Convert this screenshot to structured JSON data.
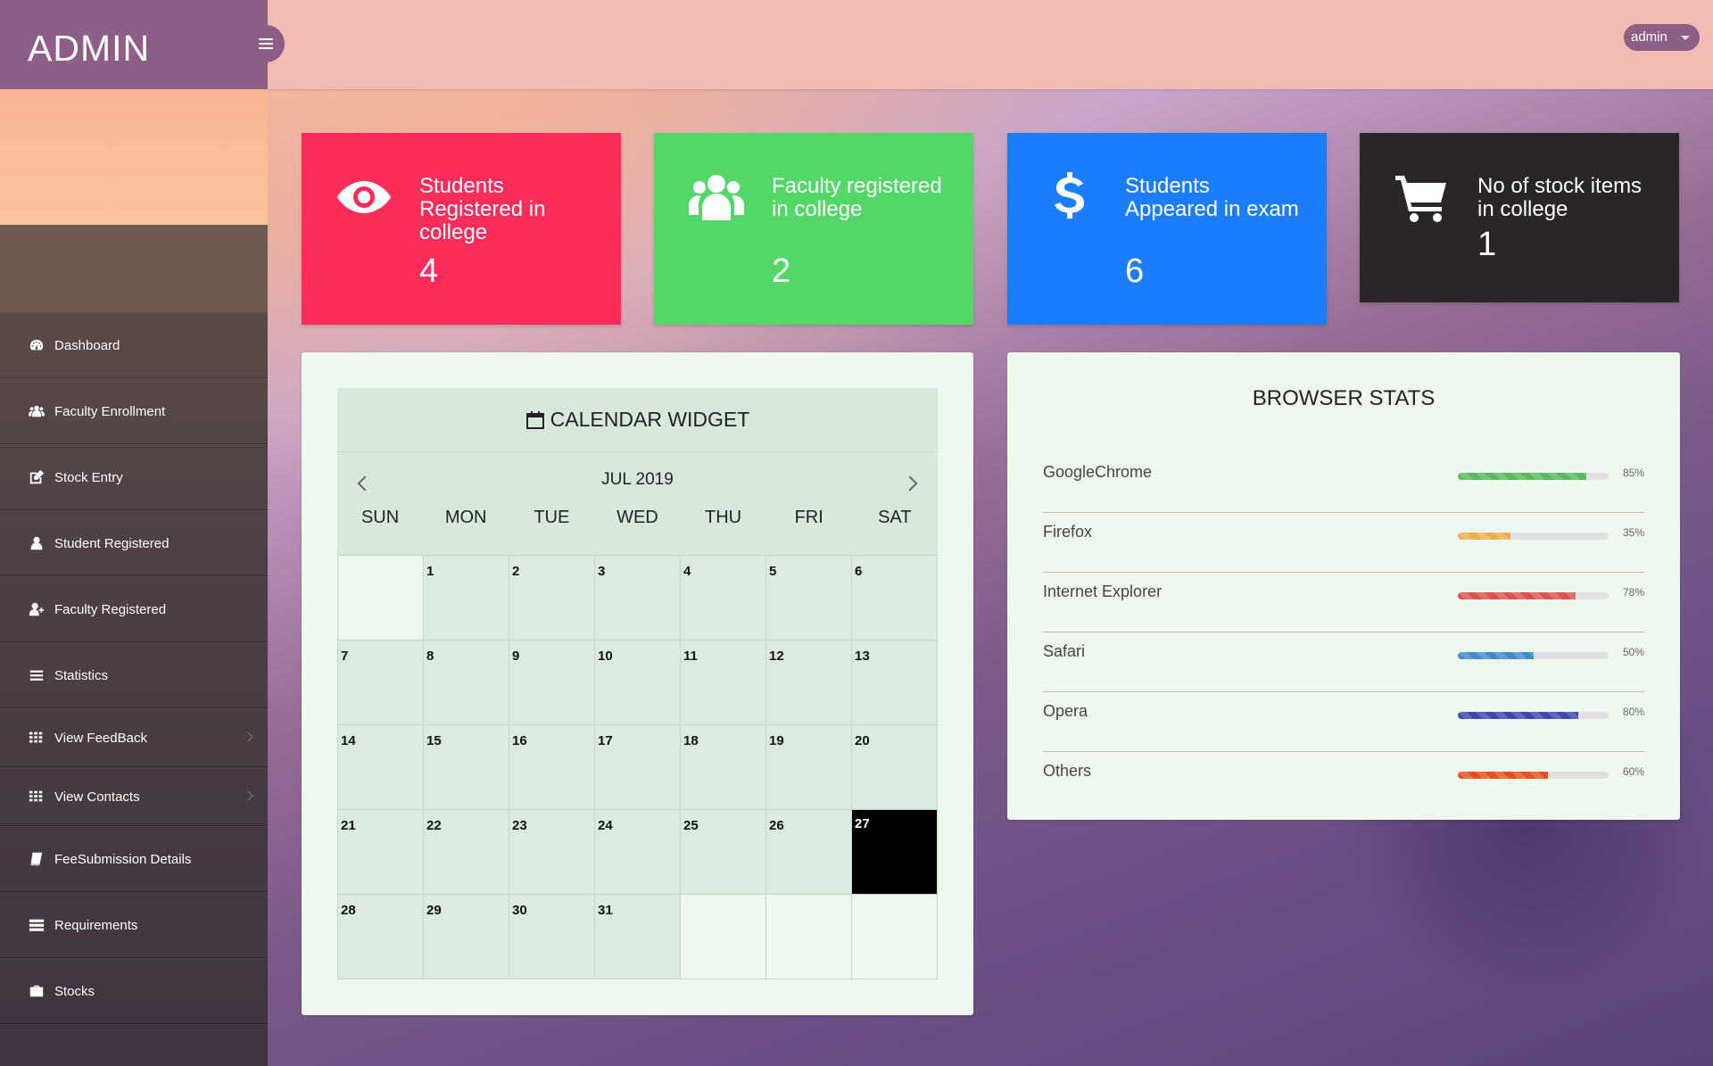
{
  "brand": {
    "title": "ADMIN"
  },
  "user": {
    "name": "admin"
  },
  "sidebar": {
    "items": [
      {
        "label": "Dashboard",
        "icon": "dashboard-icon"
      },
      {
        "label": "Faculty Enrollment",
        "icon": "users-icon"
      },
      {
        "label": "Stock Entry",
        "icon": "edit-icon"
      },
      {
        "label": "Student Registered",
        "icon": "user-icon"
      },
      {
        "label": "Faculty Registered",
        "icon": "user-plus-icon"
      },
      {
        "label": "Statistics",
        "icon": "list-icon"
      },
      {
        "label": "View FeedBack",
        "icon": "th-icon"
      },
      {
        "label": "View Contacts",
        "icon": "th-icon"
      },
      {
        "label": "FeeSubmission Details",
        "icon": "book-icon"
      },
      {
        "label": "Requirements",
        "icon": "tasks-icon"
      },
      {
        "label": "Stocks",
        "icon": "briefcase-icon"
      }
    ]
  },
  "stats": [
    {
      "label": "Students Registered in college",
      "count": "4",
      "icon": "eye-icon",
      "color": "#fb2d5a"
    },
    {
      "label": "Faculty registered in college",
      "count": "2",
      "icon": "users-icon",
      "color": "#53d769"
    },
    {
      "label": "Students Appeared in exam",
      "count": "6",
      "icon": "dollar-icon",
      "color": "#1a7eff"
    },
    {
      "label": "No of stock items in college",
      "count": "1",
      "icon": "cart-icon",
      "color": "#2a2526"
    }
  ],
  "calendar": {
    "title": "CALENDAR WIDGET",
    "month": "JUL 2019",
    "days_of_week": [
      "SUN",
      "MON",
      "TUE",
      "WED",
      "THU",
      "FRI",
      "SAT"
    ],
    "cells": [
      "",
      "1",
      "2",
      "3",
      "4",
      "5",
      "6",
      "7",
      "8",
      "9",
      "10",
      "11",
      "12",
      "13",
      "14",
      "15",
      "16",
      "17",
      "18",
      "19",
      "20",
      "21",
      "22",
      "23",
      "24",
      "25",
      "26",
      "27",
      "28",
      "29",
      "30",
      "31",
      "",
      "",
      ""
    ],
    "today": "27"
  },
  "browser_stats": {
    "title": "BROWSER STATS",
    "rows": [
      {
        "name": "GoogleChrome",
        "percent": "85%",
        "value": 85,
        "color": "#5cb85c"
      },
      {
        "name": "Firefox",
        "percent": "35%",
        "value": 35,
        "color": "#f0ad4e"
      },
      {
        "name": "Internet Explorer",
        "percent": "78%",
        "value": 78,
        "color": "#d9534f"
      },
      {
        "name": "Safari",
        "percent": "50%",
        "value": 50,
        "color": "#428bca"
      },
      {
        "name": "Opera",
        "percent": "80%",
        "value": 80,
        "color": "#3f46ad"
      },
      {
        "name": "Others",
        "percent": "60%",
        "value": 60,
        "color": "#e8511d"
      }
    ]
  }
}
